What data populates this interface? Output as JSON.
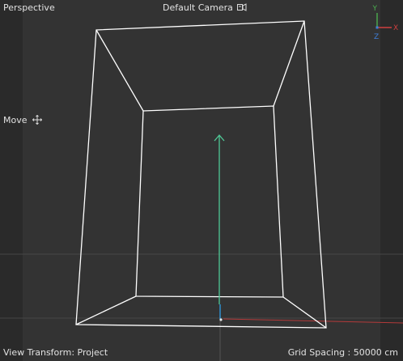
{
  "viewport": {
    "view_name": "Perspective",
    "camera_label": "Default Camera",
    "camera_icon": "camera-icon",
    "tool_label": "Move",
    "tool_icon": "move-icon",
    "view_transform": "View Transform: Project",
    "grid_spacing": "Grid Spacing : 50000 cm"
  },
  "axis_gizmo": {
    "y_label": "Y",
    "z_label": "Z",
    "x_label": "X",
    "colors": {
      "x": "#d04040",
      "y": "#4caf50",
      "z": "#3f7fd9"
    }
  },
  "scene": {
    "colors": {
      "background": "#303030",
      "grid_line": "#4a4a4a",
      "wireframe": "#ffffff",
      "manipulator_y": "#4fc896",
      "world_x_axis": "#b33a3a",
      "world_z_axis": "#2f8fd0"
    }
  }
}
